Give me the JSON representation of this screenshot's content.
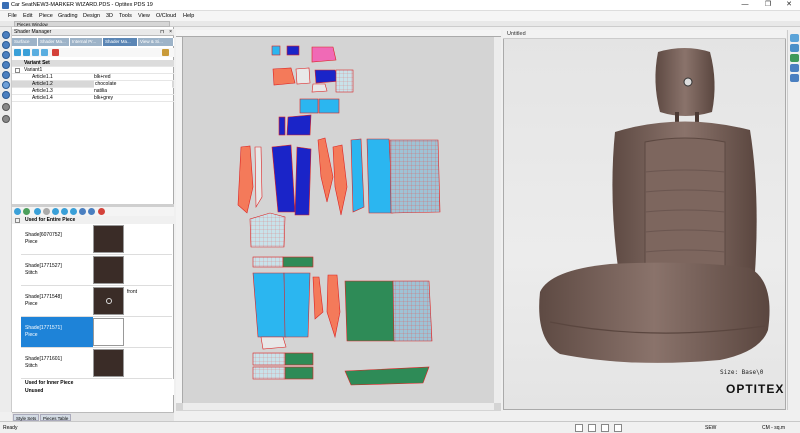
{
  "window": {
    "title": "Car SeatNEW3-MARKER WIZARD.PDS - Optitex PDS 19",
    "min_glyph": "—",
    "max_glyph": "❐",
    "close_glyph": "✕"
  },
  "menu": [
    "File",
    "Edit",
    "Piece",
    "Grading",
    "Design",
    "3D",
    "Tools",
    "View",
    "O/Cloud",
    "Help"
  ],
  "pieces_window_label": "Pieces Window",
  "shader_manager": {
    "title": "Shader Manager",
    "tabs": [
      "Surface",
      "Shader Ma...",
      "Internal Pr...",
      "Shader Ma...",
      "View & Si..."
    ],
    "active_tab": 3,
    "variant_set_header": "Variant Set",
    "rows": [
      {
        "name": "Variant1",
        "value": ""
      },
      {
        "name": "Article1.1",
        "value": "blk+red"
      },
      {
        "name": "Article1.2",
        "value": "chocolate"
      },
      {
        "name": "Article1.3",
        "value": "natilia"
      },
      {
        "name": "Article1.4",
        "value": "blk+grey"
      }
    ],
    "selected_row": 2
  },
  "shades": {
    "group_entire": "Used for Entire Piece",
    "items": [
      {
        "id": "Shade[6070752]",
        "type": "Piece",
        "swatch": "#3a2c27",
        "extra": ""
      },
      {
        "id": "Shade[1771527]",
        "type": "Stitch",
        "swatch": "#3a2c27",
        "extra": ""
      },
      {
        "id": "Shade[1771548]",
        "type": "Piece",
        "swatch": "#3a2c27",
        "extra": "front"
      },
      {
        "id": "Shade[1771571]",
        "type": "Piece",
        "swatch": "#ffffff",
        "extra": ""
      },
      {
        "id": "Shade[1771601]",
        "type": "Stitch",
        "swatch": "#3a2c27",
        "extra": ""
      }
    ],
    "selected_index": 3,
    "group_inner": "Used for Inner Piece",
    "group_unused": "Unused"
  },
  "bottom_tabs": [
    "Style Sets",
    "Pieces Table"
  ],
  "viewer": {
    "title": "Untitled",
    "size_label": "Size: Base\\0",
    "brand": "OPTITEX"
  },
  "status": {
    "left": "Ready",
    "mode": "SEW",
    "units": "CM - sq.m"
  },
  "colors": {
    "piece_orange": "#f47a5a",
    "piece_blue": "#2bb6f0",
    "piece_green": "#2e8b57",
    "piece_navy": "#1a24c8",
    "piece_pink": "#f06ab6",
    "seat_fabric": "#7a625a",
    "selection_blue": "#1e83d8"
  }
}
